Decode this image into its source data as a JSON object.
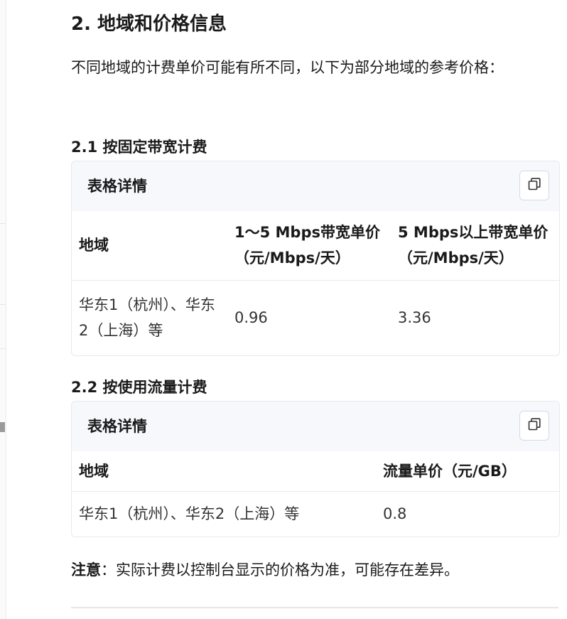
{
  "section": {
    "title": "2. 地域和价格信息",
    "intro": "不同地域的计费单价可能有所不同，以下为部分地域的参考价格："
  },
  "fixed_bandwidth": {
    "heading": "2.1 按固定带宽计费",
    "card_title": "表格详情",
    "copy_icon": "copy-icon",
    "columns": [
      "地域",
      "1～5 Mbps带宽单价（元/Mbps/天）",
      "5 Mbps以上带宽单价（元/Mbps/天）"
    ],
    "rows": [
      [
        "华东1（杭州）、华东2（上海）等",
        "0.96",
        "3.36"
      ]
    ]
  },
  "traffic": {
    "heading": "2.2 按使用流量计费",
    "card_title": "表格详情",
    "copy_icon": "copy-icon",
    "columns": [
      "地域",
      "流量单价（元/GB）"
    ],
    "rows": [
      [
        "华东1（杭州）、华东2（上海）等",
        "0.8"
      ]
    ]
  },
  "note": {
    "label": "注意",
    "text": "：实际计费以控制台显示的价格为准，可能存在差异。"
  },
  "colors": {
    "card_header_bg": "#f7f8fc",
    "border": "#e7e9ee",
    "text": "#1a1a1a"
  }
}
